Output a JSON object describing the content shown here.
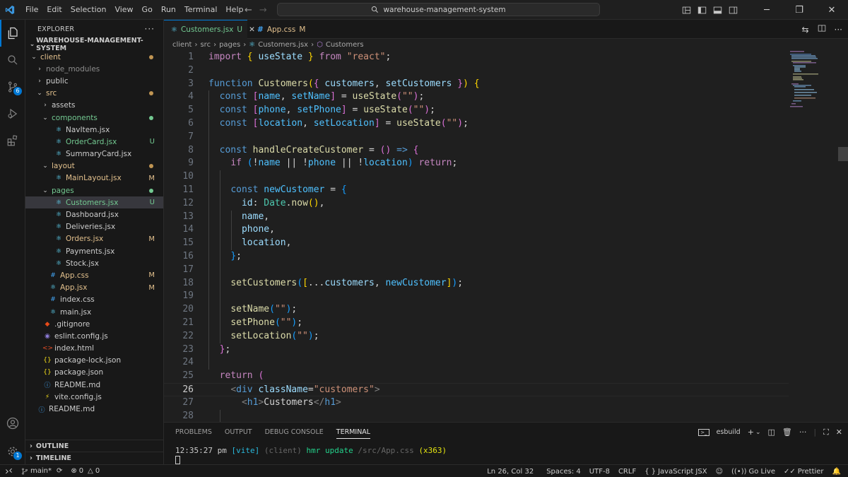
{
  "menu": [
    "File",
    "Edit",
    "Selection",
    "View",
    "Go",
    "Run",
    "Terminal",
    "Help"
  ],
  "search": {
    "text": "warehouse-management-system"
  },
  "activity": {
    "source_control_badge": "6",
    "accounts_badge": "1"
  },
  "explorer": {
    "title": "EXPLORER",
    "project": "WAREHOUSE-MANAGEMENT-SYSTEM",
    "outline": "OUTLINE",
    "timeline": "TIMELINE"
  },
  "tree": [
    {
      "label": "client",
      "type": "folder",
      "open": true,
      "depth": 1,
      "color": "#e2c08d",
      "dot": "#c09553"
    },
    {
      "label": "node_modules",
      "type": "folder",
      "open": false,
      "depth": 2,
      "color": "#8c8c8c"
    },
    {
      "label": "public",
      "type": "folder",
      "open": false,
      "depth": 2,
      "color": "#cccccc"
    },
    {
      "label": "src",
      "type": "folder",
      "open": true,
      "depth": 2,
      "color": "#e2c08d",
      "dot": "#c09553"
    },
    {
      "label": "assets",
      "type": "folder",
      "open": false,
      "depth": 3,
      "color": "#cccccc"
    },
    {
      "label": "components",
      "type": "folder",
      "open": true,
      "depth": 3,
      "color": "#73c991",
      "dot": "#73c991"
    },
    {
      "label": "NavItem.jsx",
      "type": "file",
      "icon": "react",
      "depth": 4,
      "color": "#cccccc"
    },
    {
      "label": "OrderCard.jsx",
      "type": "file",
      "icon": "react",
      "depth": 4,
      "color": "#73c991",
      "status": "U"
    },
    {
      "label": "SummaryCard.jsx",
      "type": "file",
      "icon": "react",
      "depth": 4,
      "color": "#cccccc"
    },
    {
      "label": "layout",
      "type": "folder",
      "open": true,
      "depth": 3,
      "color": "#e2c08d",
      "dot": "#c09553"
    },
    {
      "label": "MainLayout.jsx",
      "type": "file",
      "icon": "react",
      "depth": 4,
      "color": "#e2c08d",
      "status": "M"
    },
    {
      "label": "pages",
      "type": "folder",
      "open": true,
      "depth": 3,
      "color": "#73c991",
      "dot": "#73c991"
    },
    {
      "label": "Customers.jsx",
      "type": "file",
      "icon": "react",
      "depth": 4,
      "color": "#73c991",
      "status": "U",
      "selected": true
    },
    {
      "label": "Dashboard.jsx",
      "type": "file",
      "icon": "react",
      "depth": 4,
      "color": "#cccccc"
    },
    {
      "label": "Deliveries.jsx",
      "type": "file",
      "icon": "react",
      "depth": 4,
      "color": "#cccccc"
    },
    {
      "label": "Orders.jsx",
      "type": "file",
      "icon": "react",
      "depth": 4,
      "color": "#e2c08d",
      "status": "M"
    },
    {
      "label": "Payments.jsx",
      "type": "file",
      "icon": "react",
      "depth": 4,
      "color": "#cccccc"
    },
    {
      "label": "Stock.jsx",
      "type": "file",
      "icon": "react",
      "depth": 4,
      "color": "#cccccc"
    },
    {
      "label": "App.css",
      "type": "file",
      "icon": "css",
      "depth": 3,
      "color": "#e2c08d",
      "status": "M"
    },
    {
      "label": "App.jsx",
      "type": "file",
      "icon": "react",
      "depth": 3,
      "color": "#e2c08d",
      "status": "M"
    },
    {
      "label": "index.css",
      "type": "file",
      "icon": "css",
      "depth": 3,
      "color": "#cccccc"
    },
    {
      "label": "main.jsx",
      "type": "file",
      "icon": "react",
      "depth": 3,
      "color": "#cccccc"
    },
    {
      "label": ".gitignore",
      "type": "file",
      "icon": "git",
      "depth": 2,
      "color": "#cccccc"
    },
    {
      "label": "eslint.config.js",
      "type": "file",
      "icon": "eslint",
      "depth": 2,
      "color": "#cccccc"
    },
    {
      "label": "index.html",
      "type": "file",
      "icon": "html",
      "depth": 2,
      "color": "#cccccc"
    },
    {
      "label": "package-lock.json",
      "type": "file",
      "icon": "json",
      "depth": 2,
      "color": "#cccccc"
    },
    {
      "label": "package.json",
      "type": "file",
      "icon": "json",
      "depth": 2,
      "color": "#cccccc"
    },
    {
      "label": "README.md",
      "type": "file",
      "icon": "info",
      "depth": 2,
      "color": "#cccccc"
    },
    {
      "label": "vite.config.js",
      "type": "file",
      "icon": "js",
      "depth": 2,
      "color": "#cccccc"
    },
    {
      "label": "README.md",
      "type": "file",
      "icon": "info",
      "depth": 1,
      "color": "#cccccc"
    }
  ],
  "tabs": [
    {
      "label": "Customers.jsx",
      "status": "U",
      "active": true,
      "status_color": "#73c991",
      "label_color": "#73c991"
    },
    {
      "label": "App.css",
      "status": "M",
      "active": false,
      "status_color": "#e2c08d",
      "label_color": "#e2c08d"
    }
  ],
  "breadcrumbs": [
    "client",
    "src",
    "pages",
    "Customers.jsx",
    "Customers"
  ],
  "editor": {
    "current_line": 26,
    "lines": [
      [
        [
          "import",
          "k-ctrl"
        ],
        [
          " ",
          ""
        ],
        [
          "{",
          "b1"
        ],
        [
          " ",
          ""
        ],
        [
          "useState",
          "k-var"
        ],
        [
          " ",
          ""
        ],
        [
          "}",
          "b1"
        ],
        [
          " ",
          ""
        ],
        [
          "from",
          "k-ctrl"
        ],
        [
          " ",
          ""
        ],
        [
          "\"react\"",
          "k-str"
        ],
        [
          ";",
          "k-punc"
        ]
      ],
      [],
      [
        [
          "function",
          "k-kw"
        ],
        [
          " ",
          ""
        ],
        [
          "Customers",
          "k-fn"
        ],
        [
          "(",
          "b1"
        ],
        [
          "{",
          "b2"
        ],
        [
          " ",
          ""
        ],
        [
          "customers",
          "k-var"
        ],
        [
          ", ",
          "k-punc"
        ],
        [
          "setCustomers",
          "k-var"
        ],
        [
          " ",
          ""
        ],
        [
          "}",
          "b2"
        ],
        [
          ")",
          "b1"
        ],
        [
          " ",
          ""
        ],
        [
          "{",
          "b1"
        ]
      ],
      [
        [
          "  ",
          ""
        ],
        [
          "const",
          "k-kw"
        ],
        [
          " ",
          ""
        ],
        [
          "[",
          "b2"
        ],
        [
          "name",
          "k-const"
        ],
        [
          ", ",
          "k-punc"
        ],
        [
          "setName",
          "k-const"
        ],
        [
          "]",
          "b2"
        ],
        [
          " = ",
          "k-punc"
        ],
        [
          "useState",
          "k-fn"
        ],
        [
          "(",
          "b2"
        ],
        [
          "\"\"",
          "k-str"
        ],
        [
          ")",
          "b2"
        ],
        [
          ";",
          "k-punc"
        ]
      ],
      [
        [
          "  ",
          ""
        ],
        [
          "const",
          "k-kw"
        ],
        [
          " ",
          ""
        ],
        [
          "[",
          "b2"
        ],
        [
          "phone",
          "k-const"
        ],
        [
          ", ",
          "k-punc"
        ],
        [
          "setPhone",
          "k-const"
        ],
        [
          "]",
          "b2"
        ],
        [
          " = ",
          "k-punc"
        ],
        [
          "useState",
          "k-fn"
        ],
        [
          "(",
          "b2"
        ],
        [
          "\"\"",
          "k-str"
        ],
        [
          ")",
          "b2"
        ],
        [
          ";",
          "k-punc"
        ]
      ],
      [
        [
          "  ",
          ""
        ],
        [
          "const",
          "k-kw"
        ],
        [
          " ",
          ""
        ],
        [
          "[",
          "b2"
        ],
        [
          "location",
          "k-const"
        ],
        [
          ", ",
          "k-punc"
        ],
        [
          "setLocation",
          "k-const"
        ],
        [
          "]",
          "b2"
        ],
        [
          " = ",
          "k-punc"
        ],
        [
          "useState",
          "k-fn"
        ],
        [
          "(",
          "b2"
        ],
        [
          "\"\"",
          "k-str"
        ],
        [
          ")",
          "b2"
        ],
        [
          ";",
          "k-punc"
        ]
      ],
      [],
      [
        [
          "  ",
          ""
        ],
        [
          "const",
          "k-kw"
        ],
        [
          " ",
          ""
        ],
        [
          "handleCreateCustomer",
          "k-fn"
        ],
        [
          " = ",
          "k-punc"
        ],
        [
          "(",
          "b2"
        ],
        [
          ")",
          "b2"
        ],
        [
          " ",
          ""
        ],
        [
          "=>",
          "k-kw"
        ],
        [
          " ",
          ""
        ],
        [
          "{",
          "b2"
        ]
      ],
      [
        [
          "    ",
          ""
        ],
        [
          "if",
          "k-ctrl"
        ],
        [
          " ",
          ""
        ],
        [
          "(",
          "b3"
        ],
        [
          "!",
          "k-punc"
        ],
        [
          "name",
          "k-const"
        ],
        [
          " || ",
          "k-punc"
        ],
        [
          "!",
          "k-punc"
        ],
        [
          "phone",
          "k-const"
        ],
        [
          " || ",
          "k-punc"
        ],
        [
          "!",
          "k-punc"
        ],
        [
          "location",
          "k-const"
        ],
        [
          ")",
          "b3"
        ],
        [
          " ",
          ""
        ],
        [
          "return",
          "k-ctrl"
        ],
        [
          ";",
          "k-punc"
        ]
      ],
      [],
      [
        [
          "    ",
          ""
        ],
        [
          "const",
          "k-kw"
        ],
        [
          " ",
          ""
        ],
        [
          "newCustomer",
          "k-const"
        ],
        [
          " = ",
          "k-punc"
        ],
        [
          "{",
          "b3"
        ]
      ],
      [
        [
          "      ",
          ""
        ],
        [
          "id",
          "k-var"
        ],
        [
          ": ",
          "k-punc"
        ],
        [
          "Date",
          "k-type"
        ],
        [
          ".",
          "k-punc"
        ],
        [
          "now",
          "k-fn"
        ],
        [
          "(",
          "b1"
        ],
        [
          ")",
          "b1"
        ],
        [
          ",",
          "k-punc"
        ]
      ],
      [
        [
          "      ",
          ""
        ],
        [
          "name",
          "k-var"
        ],
        [
          ",",
          "k-punc"
        ]
      ],
      [
        [
          "      ",
          ""
        ],
        [
          "phone",
          "k-var"
        ],
        [
          ",",
          "k-punc"
        ]
      ],
      [
        [
          "      ",
          ""
        ],
        [
          "location",
          "k-var"
        ],
        [
          ",",
          "k-punc"
        ]
      ],
      [
        [
          "    ",
          ""
        ],
        [
          "}",
          "b3"
        ],
        [
          ";",
          "k-punc"
        ]
      ],
      [],
      [
        [
          "    ",
          ""
        ],
        [
          "setCustomers",
          "k-fn"
        ],
        [
          "(",
          "b3"
        ],
        [
          "[",
          "b1"
        ],
        [
          "...",
          "k-punc"
        ],
        [
          "customers",
          "k-var"
        ],
        [
          ", ",
          "k-punc"
        ],
        [
          "newCustomer",
          "k-const"
        ],
        [
          "]",
          "b1"
        ],
        [
          ")",
          "b3"
        ],
        [
          ";",
          "k-punc"
        ]
      ],
      [],
      [
        [
          "    ",
          ""
        ],
        [
          "setName",
          "k-fn"
        ],
        [
          "(",
          "b3"
        ],
        [
          "\"\"",
          "k-str"
        ],
        [
          ")",
          "b3"
        ],
        [
          ";",
          "k-punc"
        ]
      ],
      [
        [
          "    ",
          ""
        ],
        [
          "setPhone",
          "k-fn"
        ],
        [
          "(",
          "b3"
        ],
        [
          "\"\"",
          "k-str"
        ],
        [
          ")",
          "b3"
        ],
        [
          ";",
          "k-punc"
        ]
      ],
      [
        [
          "    ",
          ""
        ],
        [
          "setLocation",
          "k-fn"
        ],
        [
          "(",
          "b3"
        ],
        [
          "\"\"",
          "k-str"
        ],
        [
          ")",
          "b3"
        ],
        [
          ";",
          "k-punc"
        ]
      ],
      [
        [
          "  ",
          ""
        ],
        [
          "}",
          "b2"
        ],
        [
          ";",
          "k-punc"
        ]
      ],
      [],
      [
        [
          "  ",
          ""
        ],
        [
          "return",
          "k-ctrl"
        ],
        [
          " ",
          ""
        ],
        [
          "(",
          "b2"
        ]
      ],
      [
        [
          "    ",
          ""
        ],
        [
          "<",
          "k-gray"
        ],
        [
          "div",
          "k-tag"
        ],
        [
          " ",
          ""
        ],
        [
          "className",
          "k-var"
        ],
        [
          "=",
          "k-punc"
        ],
        [
          "\"customers\"",
          "k-str"
        ],
        [
          ">",
          "k-gray"
        ]
      ],
      [
        [
          "      ",
          ""
        ],
        [
          "<",
          "k-gray"
        ],
        [
          "h1",
          "k-tag"
        ],
        [
          ">",
          "k-gray"
        ],
        [
          "Customers",
          "k-punc"
        ],
        [
          "</",
          "k-gray"
        ],
        [
          "h1",
          "k-tag"
        ],
        [
          ">",
          "k-gray"
        ]
      ],
      []
    ]
  },
  "panel": {
    "tabs": [
      "PROBLEMS",
      "OUTPUT",
      "DEBUG CONSOLE",
      "TERMINAL"
    ],
    "active_tab": "TERMINAL",
    "terminal_name": "esbuild",
    "terminal_line": [
      [
        "12:35:27 pm",
        "#cccccc"
      ],
      [
        " ",
        ""
      ],
      [
        "[vite]",
        "#29b8db"
      ],
      [
        " ",
        ""
      ],
      [
        "(client)",
        "#666666"
      ],
      [
        " ",
        ""
      ],
      [
        "hmr update",
        "#23d18b"
      ],
      [
        " ",
        ""
      ],
      [
        "/src/App.css",
        "#666666"
      ],
      [
        " ",
        ""
      ],
      [
        "(x363)",
        "#e5e510"
      ]
    ]
  },
  "status": {
    "branch": "main*",
    "errors": "0",
    "warnings": "0",
    "position": "Ln 26, Col 32",
    "spaces": "Spaces: 4",
    "encoding": "UTF-8",
    "eol": "CRLF",
    "language": "JavaScript JSX",
    "go_live": "Go Live",
    "prettier": "Prettier"
  }
}
